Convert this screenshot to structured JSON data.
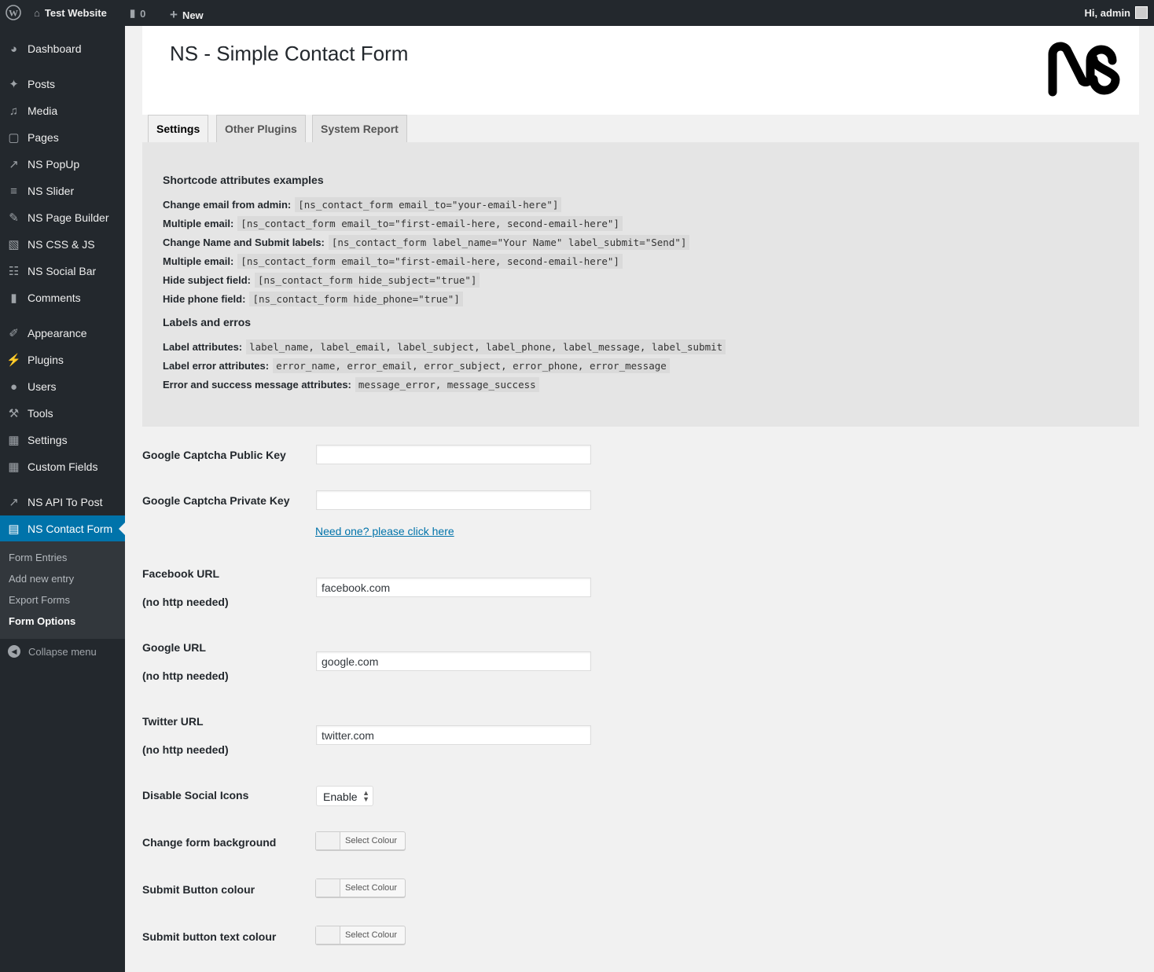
{
  "adminbar": {
    "site": "Test Website",
    "comments": "0",
    "new": "New",
    "greeting": "Hi, admin"
  },
  "sidebar": {
    "items": [
      "Dashboard",
      "Posts",
      "Media",
      "Pages",
      "NS PopUp",
      "NS Slider",
      "NS Page Builder",
      "NS CSS & JS",
      "NS Social Bar",
      "Comments",
      "Appearance",
      "Plugins",
      "Users",
      "Tools",
      "Settings",
      "Custom Fields",
      "NS API To Post",
      "NS Contact Form"
    ],
    "submenu": [
      "Form Entries",
      "Add new entry",
      "Export Forms",
      "Form Options"
    ],
    "collapse": "Collapse menu"
  },
  "header": {
    "title": "NS - Simple Contact Form",
    "logo": "NS"
  },
  "tabs": [
    "Settings",
    "Other Plugins",
    "System Report"
  ],
  "info": {
    "h1": "Shortcode attributes examples",
    "lines": [
      {
        "label": "Change email from admin:",
        "code": "[ns_contact_form email_to=\"your-email-here\"]"
      },
      {
        "label": "Multiple email:",
        "code": "[ns_contact_form email_to=\"first-email-here, second-email-here\"]"
      },
      {
        "label": "Change Name and Submit labels:",
        "code": "[ns_contact_form label_name=\"Your Name\" label_submit=\"Send\"]"
      },
      {
        "label": "Multiple email:",
        "code": "[ns_contact_form email_to=\"first-email-here, second-email-here\"]"
      },
      {
        "label": "Hide subject field:",
        "code": "[ns_contact_form hide_subject=\"true\"]"
      },
      {
        "label": "Hide phone field:",
        "code": "[ns_contact_form hide_phone=\"true\"]"
      }
    ],
    "h2": "Labels and erros",
    "lines2": [
      {
        "label": "Label attributes:",
        "code": "label_name, label_email, label_subject, label_phone, label_message, label_submit"
      },
      {
        "label": "Label error attributes:",
        "code": "error_name, error_email, error_subject, error_phone, error_message"
      },
      {
        "label": "Error and success message attributes:",
        "code": "message_error, message_success"
      }
    ]
  },
  "form": {
    "captcha_public": {
      "label": "Google Captcha Public Key",
      "value": ""
    },
    "captcha_private": {
      "label": "Google Captcha Private Key",
      "value": ""
    },
    "captcha_link": "Need one? please click here",
    "facebook": {
      "label": "Facebook URL",
      "note": "(no http needed)",
      "value": "facebook.com"
    },
    "google": {
      "label": "Google URL",
      "note": "(no http needed)",
      "value": "google.com"
    },
    "twitter": {
      "label": "Twitter URL",
      "note": "(no http needed)",
      "value": "twitter.com"
    },
    "social": {
      "label": "Disable Social Icons",
      "value": "Enable"
    },
    "bg": {
      "label": "Change form background",
      "button": "Select Colour"
    },
    "btn": {
      "label": "Submit Button colour",
      "button": "Select Colour"
    },
    "btntext": {
      "label": "Submit button text colour",
      "button": "Select Colour"
    }
  }
}
